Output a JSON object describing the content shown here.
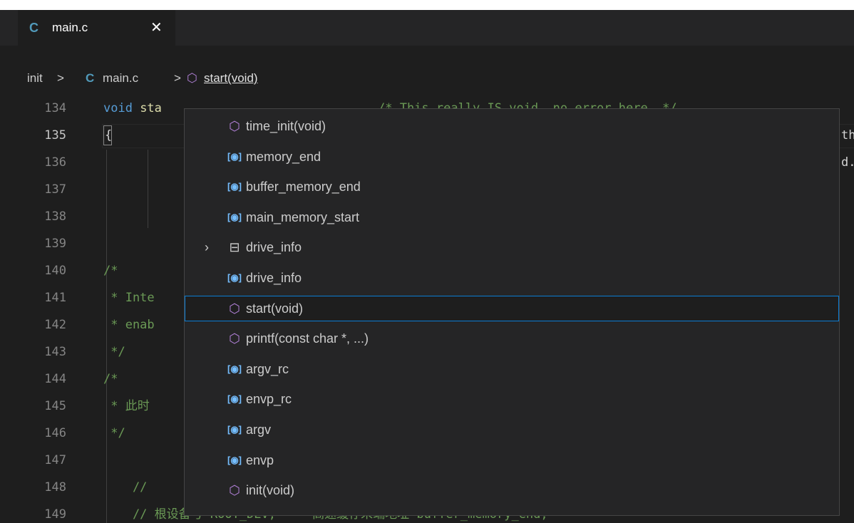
{
  "tab": {
    "icon": "c-file-icon",
    "icon_glyph": "C",
    "label": "main.c",
    "close": "✕"
  },
  "breadcrumb": {
    "items": [
      "init",
      "main.c",
      "start(void)"
    ],
    "sep": ">",
    "c_glyph": "C",
    "method_glyph": "⬡"
  },
  "editor": {
    "lines": [
      {
        "num": "134"
      },
      {
        "num": "135",
        "active": true
      },
      {
        "num": "136"
      },
      {
        "num": "137"
      },
      {
        "num": "138"
      },
      {
        "num": "139"
      },
      {
        "num": "140"
      },
      {
        "num": "141"
      },
      {
        "num": "142"
      },
      {
        "num": "143"
      },
      {
        "num": "144"
      },
      {
        "num": "145"
      },
      {
        "num": "146"
      },
      {
        "num": "147"
      },
      {
        "num": "148"
      },
      {
        "num": "149"
      }
    ],
    "code": {
      "l134_kw": "void",
      "l134_fn": " sta",
      "l134_rest": "",
      "l134_comment_right": "/* This really IS void, no error here. */",
      "l135": "{",
      "l135_right": "th",
      "l136_right": "d.",
      "l140": "/*",
      "l141": " * Inte",
      "l142": " * enab",
      "l143": " */",
      "l144": "/*",
      "l145": " * 此时",
      "l146": " */",
      "l148": "    // ",
      "l149": "    // 根设备号 ROOT_DEV;     高速缓存末端地址 buffer_memory_end;"
    }
  },
  "suggest": {
    "selected_index": 7,
    "items": [
      {
        "kind": "method",
        "icon": "method-cube-icon",
        "label": "time_init(void)"
      },
      {
        "kind": "variable",
        "icon": "variable-icon",
        "label": "memory_end"
      },
      {
        "kind": "variable",
        "icon": "variable-icon",
        "label": "buffer_memory_end"
      },
      {
        "kind": "variable",
        "icon": "variable-icon",
        "label": "main_memory_start"
      },
      {
        "kind": "struct",
        "icon": "struct-icon",
        "label": "drive_info",
        "expandable": true
      },
      {
        "kind": "variable",
        "icon": "variable-icon",
        "label": "drive_info"
      },
      {
        "kind": "method",
        "icon": "method-cube-icon",
        "label": "start(void)"
      },
      {
        "kind": "method",
        "icon": "method-cube-icon",
        "label": "printf(const char *, ...)"
      },
      {
        "kind": "variable",
        "icon": "variable-icon",
        "label": "argv_rc"
      },
      {
        "kind": "variable",
        "icon": "variable-icon",
        "label": "envp_rc"
      },
      {
        "kind": "variable",
        "icon": "variable-icon",
        "label": "argv"
      },
      {
        "kind": "variable",
        "icon": "variable-icon",
        "label": "envp"
      },
      {
        "kind": "method",
        "icon": "method-cube-icon",
        "label": "init(void)"
      }
    ],
    "glyphs": {
      "method": "⬡",
      "variable": "[◉]",
      "struct": "⊟",
      "chevron": "›"
    }
  }
}
